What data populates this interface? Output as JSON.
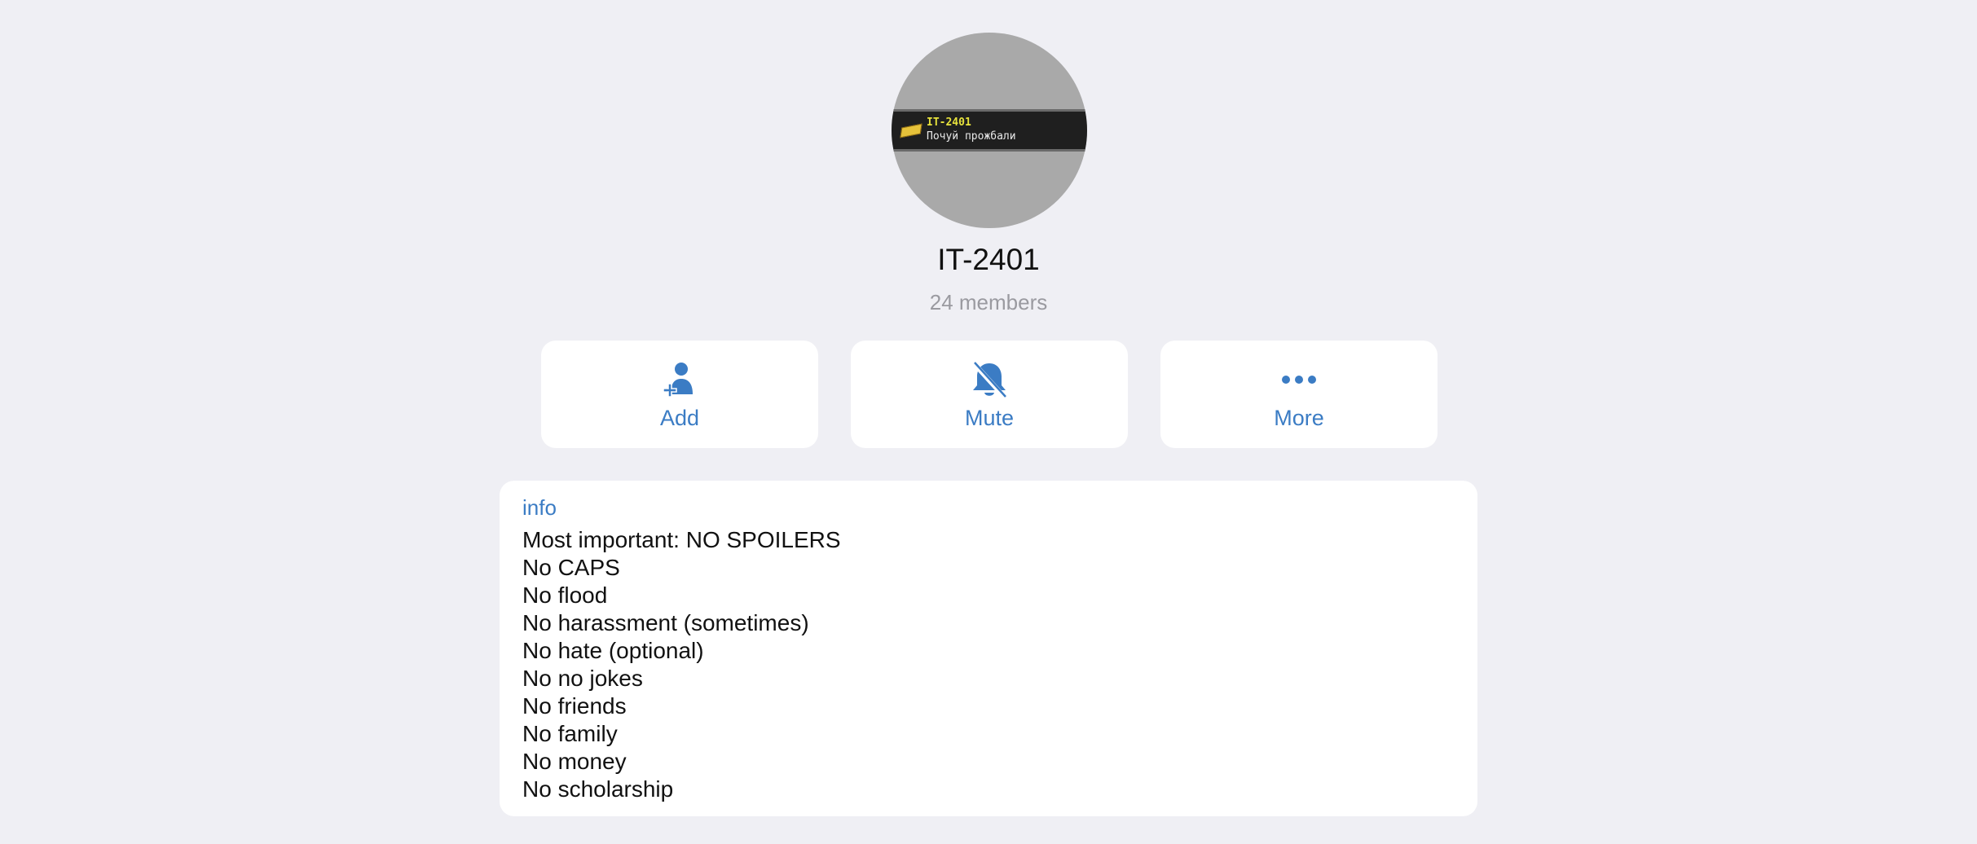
{
  "header": {
    "title": "IT-2401",
    "subtitle": "24 members"
  },
  "avatar": {
    "line1": "IT-2401",
    "line2": "Почуй прожбали"
  },
  "actions": [
    {
      "label": "Add",
      "icon": "add-member-icon"
    },
    {
      "label": "Mute",
      "icon": "bell-slash-icon"
    },
    {
      "label": "More",
      "icon": "ellipsis-icon"
    }
  ],
  "info": {
    "label": "info",
    "lines": [
      "Most important: NO SPOILERS",
      "No CAPS",
      "No flood",
      "No harassment (sometimes)",
      "No hate (optional)",
      "No no jokes",
      "No friends",
      "No family",
      "No money",
      "No scholarship"
    ]
  },
  "colors": {
    "background": "#efeff4",
    "accent": "#3b7cc4",
    "card": "#ffffff",
    "secondary_text": "#9a9aa0"
  }
}
